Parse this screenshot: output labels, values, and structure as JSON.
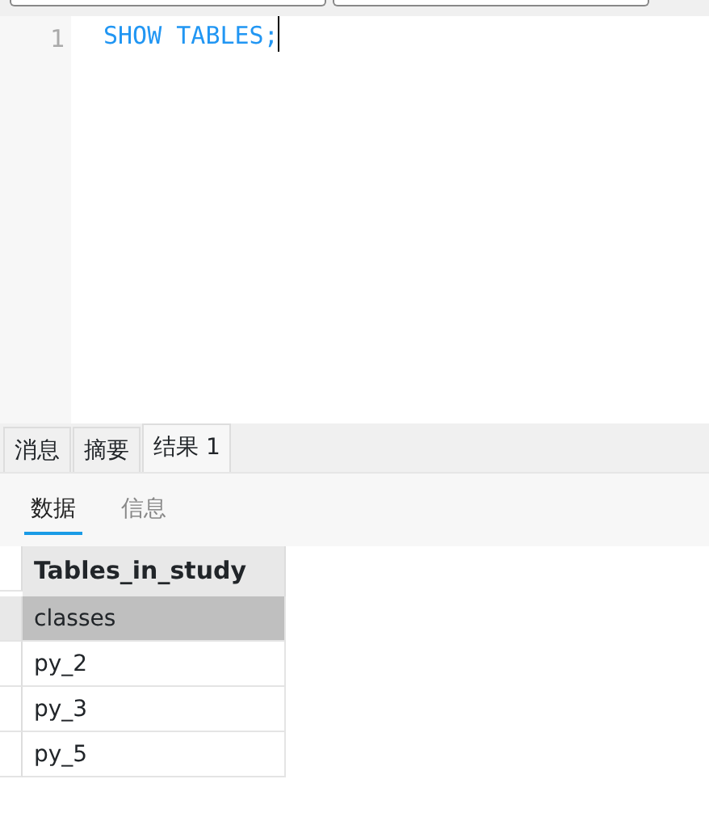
{
  "editor": {
    "lines": [
      {
        "number": "1",
        "code": "SHOW TABLES;"
      }
    ]
  },
  "result_tabs": [
    {
      "label": "消息",
      "selected": false
    },
    {
      "label": "摘要",
      "selected": false
    },
    {
      "label": "结果 1",
      "selected": true
    }
  ],
  "sub_tabs": [
    {
      "label": "数据",
      "selected": true
    },
    {
      "label": "信息",
      "selected": false
    }
  ],
  "table": {
    "columns": [
      "Tables_in_study"
    ],
    "rows": [
      {
        "cells": [
          "classes"
        ],
        "selected": true
      },
      {
        "cells": [
          "py_2"
        ],
        "selected": false
      },
      {
        "cells": [
          "py_3"
        ],
        "selected": false
      },
      {
        "cells": [
          "py_5"
        ],
        "selected": false
      }
    ]
  }
}
